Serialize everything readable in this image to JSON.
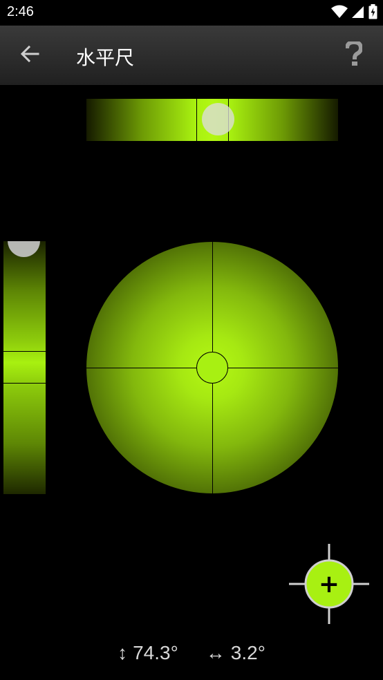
{
  "status": {
    "time": "2:46",
    "icons": [
      "wifi-icon",
      "signal-icon",
      "battery-charging-icon"
    ]
  },
  "app_bar": {
    "title": "水平尺",
    "back_icon": "arrow-left-icon",
    "help_icon": "question-mark-icon"
  },
  "levels": {
    "accent_color": "#a8f010"
  },
  "calibrate": {
    "icon": "plus-crosshair-icon",
    "symbol": "+"
  },
  "readout": {
    "vertical_arrow": "↕",
    "vertical_value": "74.3°",
    "horizontal_arrow": "↔",
    "horizontal_value": "3.2°"
  }
}
